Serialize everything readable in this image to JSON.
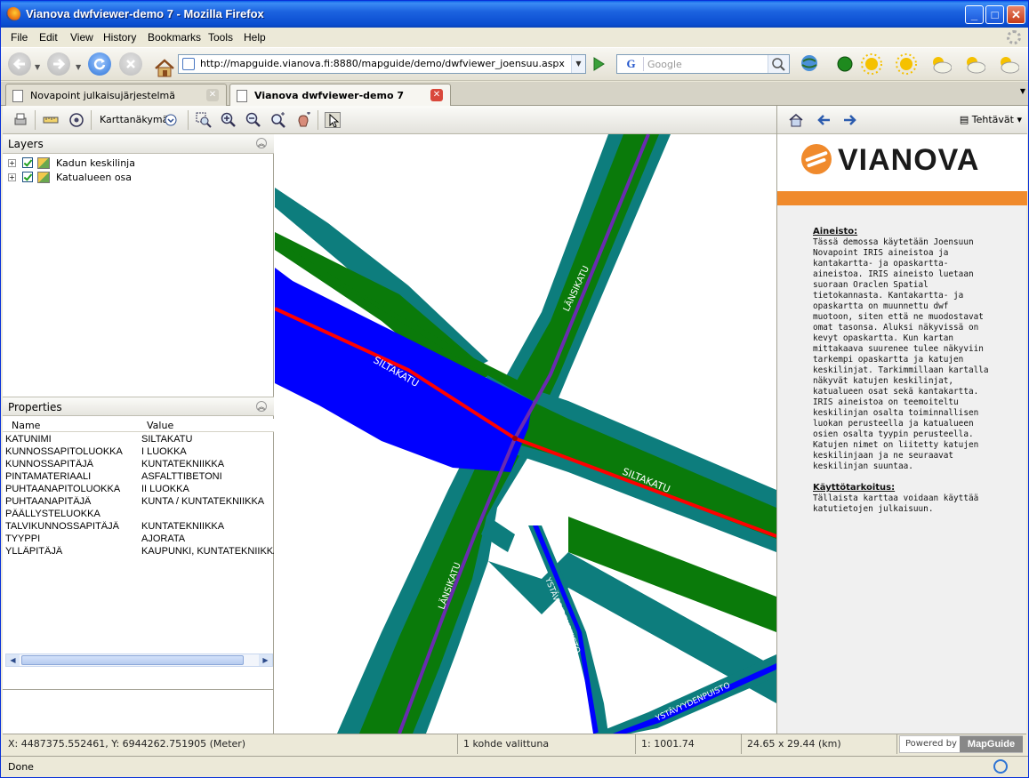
{
  "window": {
    "title": "Vianova dwfviewer-demo 7 - Mozilla Firefox"
  },
  "menu": [
    "File",
    "Edit",
    "View",
    "History",
    "Bookmarks",
    "Tools",
    "Help"
  ],
  "address": {
    "url": "http://mapguide.vianova.fi:8880/mapguide/demo/dwfviewer_joensuu.aspx",
    "search_placeholder": "Google"
  },
  "tabs": [
    {
      "label": "Novapoint julkaisujärjestelmä",
      "active": false
    },
    {
      "label": "Vianova dwfviewer-demo 7",
      "active": true
    }
  ],
  "viewer": {
    "toolbar": {
      "view_dropdown": "Karttanäkymä"
    },
    "layers": {
      "title": "Layers",
      "items": [
        {
          "label": "Kadun keskilinja",
          "checked": true
        },
        {
          "label": "Katualueen osa",
          "checked": true
        }
      ]
    },
    "properties": {
      "title": "Properties",
      "col_name": "Name",
      "col_value": "Value",
      "rows": [
        {
          "name": "KATUNIMI",
          "value": "SILTAKATU"
        },
        {
          "name": "KUNNOSSAPITOLUOKKA",
          "value": "I LUOKKA"
        },
        {
          "name": "KUNNOSSAPITÄJÄ",
          "value": "KUNTATEKNIIKKA"
        },
        {
          "name": "PINTAMATERIAALI",
          "value": "ASFALTTIBETONI"
        },
        {
          "name": "PUHTAANAPITOLUOKKA",
          "value": "II LUOKKA"
        },
        {
          "name": "PUHTAANAPITÄJÄ",
          "value": "KUNTA / KUNTATEKNIIKKA"
        },
        {
          "name": "PÄÄLLYSTELUOKKA",
          "value": ""
        },
        {
          "name": "TALVIKUNNOSSAPITÄJÄ",
          "value": "KUNTATEKNIIKKA"
        },
        {
          "name": "TYYPPI",
          "value": "AJORATA"
        },
        {
          "name": "YLLÄPITÄJÄ",
          "value": "KAUPUNKI, KUNTATEKNIIKKA"
        }
      ]
    },
    "map_labels": {
      "siltakatu": "SILTAKATU",
      "lansikatu": "LÄNSIKATU",
      "ystavyydenpuisto": "YSTÄVYYDENPUISTO"
    },
    "task_pane": {
      "tasks_label": "Tehtävät",
      "logo_text": "VIANOVA",
      "aineisto_heading": "Aineisto:",
      "aineisto_text": "Tässä demossa käytetään Joensuun Novapoint IRIS aineistoa ja kantakartta- ja opaskartta-aineistoa. IRIS aineisto luetaan suoraan Oraclen Spatial tietokannasta. Kantakartta- ja opaskartta on muunnettu dwf muotoon, siten että ne muodostavat omat tasonsa. Aluksi näkyvissä on kevyt opaskartta. Kun kartan mittakaava suurenee tulee näkyviin tarkempi opaskartta ja katujen keskilinjat. Tarkimmillaan kartalla näkyvät katujen keskilinjat, katualueen osat sekä kantakartta. IRIS aineistoa on teemoiteltu keskilinjan osalta toiminnallisen luokan perusteella ja katualueen osien osalta tyypin perusteella. Katujen nimet on liitetty katujen keskilinjaan ja ne seuraavat keskilinjan suuntaa.",
      "kaytto_heading": "Käyttötarkoitus:",
      "kaytto_text": "Tällaista karttaa voidaan käyttää katutietojen julkaisuun."
    },
    "status": {
      "coords": "X: 4487375.552461, Y: 6944262.751905 (Meter)",
      "selection": "1 kohde valittuna",
      "scale": "1: 1001.74",
      "size": "24.65 x 29.44 (km)",
      "powered_by": "Powered by",
      "mapguide": "MapGuide"
    }
  },
  "browser_status": "Done",
  "colors": {
    "street_area_green": "#0a7a0a",
    "sidewalk_teal": "#0d7d7d",
    "water_blue": "#0000ff",
    "centerline_red": "#ff0000",
    "centerline_purple": "#6a2bb0",
    "brand_orange": "#f08a2c"
  }
}
